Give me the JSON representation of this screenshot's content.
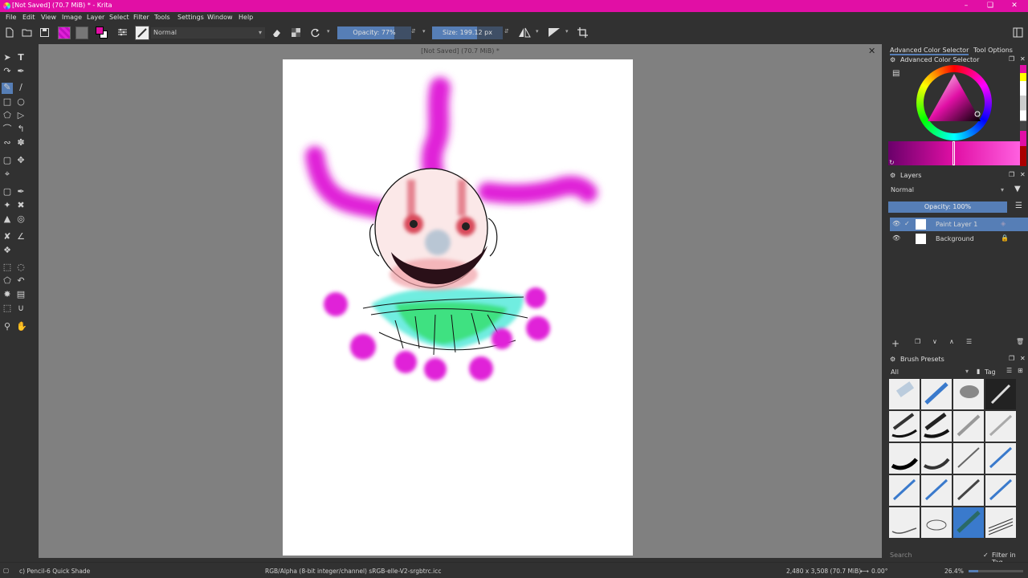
{
  "window": {
    "title": "[Not Saved]  (70.7 MiB) * - Krita",
    "minimize_icon": "minimize-icon",
    "maximize_icon": "maximize-icon",
    "close_icon": "close-icon"
  },
  "menu": [
    "File",
    "Edit",
    "View",
    "Image",
    "Layer",
    "Select",
    "Filter",
    "Tools",
    "Settings",
    "Window",
    "Help"
  ],
  "toolbar": {
    "blend_mode": "Normal",
    "opacity_label": "Opacity: 77%",
    "opacity_value": 0.77,
    "size_label": "Size: 199.12 px"
  },
  "document": {
    "tab_title": "[Not Saved]  (70.7 MiB) *"
  },
  "colors": {
    "accent": "#e10fa5",
    "brush_magenta": "#e020d8",
    "collar_cyan": "#4ee8d8",
    "collar_green": "#38e078",
    "selection_blue": "#567eb6"
  },
  "docker_tabs": [
    "Advanced Color Selector",
    "Tool Options"
  ],
  "color_selector": {
    "title": "Advanced Color Selector"
  },
  "layers": {
    "title": "Layers",
    "blend_mode": "Normal",
    "opacity_label": "Opacity:  100%",
    "items": [
      {
        "name": "Paint Layer 1",
        "selected": true
      },
      {
        "name": "Background",
        "selected": false
      }
    ]
  },
  "brush_presets": {
    "title": "Brush Presets",
    "filter": "All",
    "tag_label": "Tag",
    "search_placeholder": "Search",
    "filter_in_tag": "Filter in Tag"
  },
  "status": {
    "brush": "c) Pencil-6 Quick Shade",
    "color_space": "RGB/Alpha (8-bit integer/channel)  sRGB-elle-V2-srgbtrc.icc",
    "dimensions": "2,480 x 3,508 (70.7 MiB)",
    "rotation": "0.00°",
    "zoom": "26.4%"
  }
}
